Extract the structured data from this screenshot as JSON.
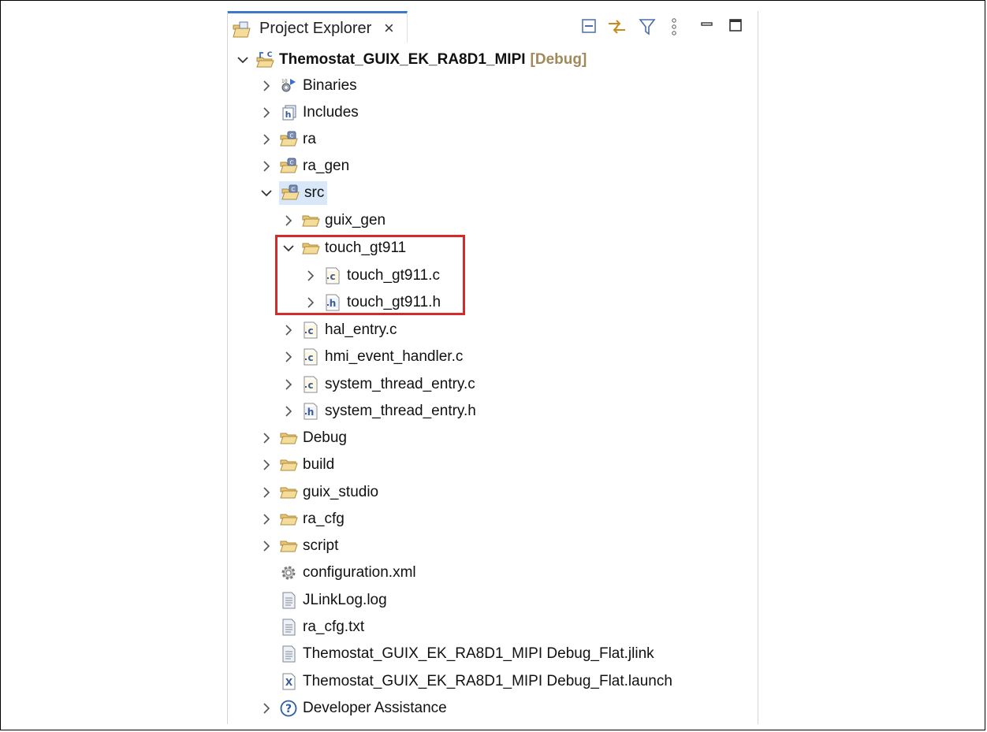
{
  "panel": {
    "tab_label": "Project Explorer",
    "toolbar": [
      "collapse-all-icon",
      "link-editor-icon",
      "filter-icon",
      "view-menu-icon",
      "minimize-icon",
      "maximize-icon"
    ]
  },
  "tree": {
    "root": {
      "label": "Themostat_GUIX_EK_RA8D1_MIPI",
      "tag": "[Debug]"
    },
    "items": [
      {
        "label": "Binaries",
        "icon": "binaries-icon"
      },
      {
        "label": "Includes",
        "icon": "includes-icon"
      },
      {
        "label": "ra",
        "icon": "source-folder-icon"
      },
      {
        "label": "ra_gen",
        "icon": "source-folder-icon"
      },
      {
        "label": "src",
        "icon": "source-folder-icon"
      },
      {
        "label": "guix_gen",
        "icon": "folder-icon"
      },
      {
        "label": "touch_gt911",
        "icon": "folder-icon"
      },
      {
        "label": "touch_gt911.c",
        "icon": "c-file-icon"
      },
      {
        "label": "touch_gt911.h",
        "icon": "h-file-icon"
      },
      {
        "label": "hal_entry.c",
        "icon": "c-file-icon"
      },
      {
        "label": "hmi_event_handler.c",
        "icon": "c-file-icon"
      },
      {
        "label": "system_thread_entry.c",
        "icon": "c-file-icon"
      },
      {
        "label": "system_thread_entry.h",
        "icon": "h-file-icon"
      },
      {
        "label": "Debug",
        "icon": "folder-icon"
      },
      {
        "label": "build",
        "icon": "folder-icon"
      },
      {
        "label": "guix_studio",
        "icon": "folder-icon"
      },
      {
        "label": "ra_cfg",
        "icon": "folder-icon"
      },
      {
        "label": "script",
        "icon": "folder-icon"
      },
      {
        "label": "configuration.xml",
        "icon": "gear-icon"
      },
      {
        "label": "JLinkLog.log",
        "icon": "text-file-icon"
      },
      {
        "label": "ra_cfg.txt",
        "icon": "text-file-icon"
      },
      {
        "label": "Themostat_GUIX_EK_RA8D1_MIPI Debug_Flat.jlink",
        "icon": "text-file-icon"
      },
      {
        "label": "Themostat_GUIX_EK_RA8D1_MIPI Debug_Flat.launch",
        "icon": "launch-file-icon"
      },
      {
        "label": "Developer Assistance",
        "icon": "help-icon"
      }
    ]
  }
}
